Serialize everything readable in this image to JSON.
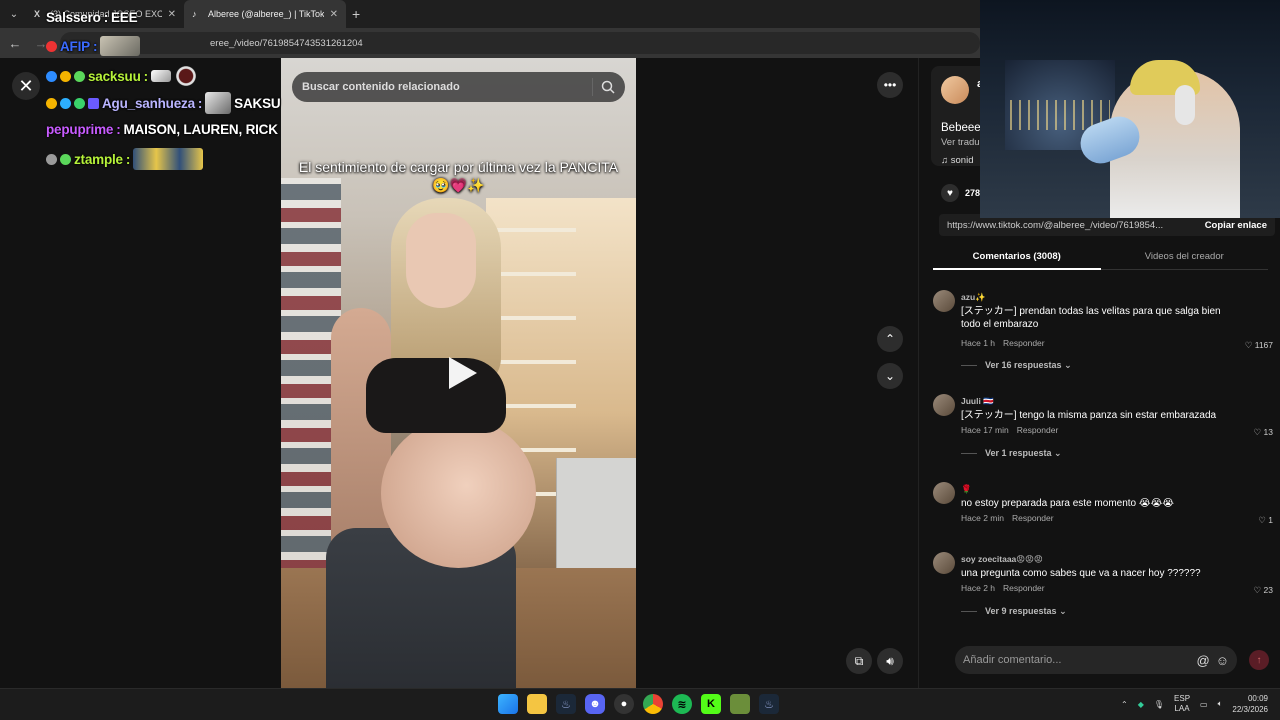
{
  "browser": {
    "tabs": [
      {
        "title": "(3) Comunidad JOSEO EXCLU...",
        "favicon": "X",
        "active": false
      },
      {
        "title": "Alberee (@alberee_) | TikTok",
        "favicon": "♪",
        "active": true
      }
    ],
    "url_visible": "eree_/video/7619854743531261204"
  },
  "page": {
    "search_placeholder": "Buscar contenido relacionado",
    "video_caption": "El sentimiento de cargar por última vez la PANCITA🥹💗✨",
    "creator_initial": "a",
    "description": "Bebeee",
    "translate_label": "Ver tradu",
    "music_label": "♫  sonid",
    "likes": "278.",
    "share_link": "https://www.tiktok.com/@alberee_/video/7619854...",
    "copy_link_label": "Copiar enlace",
    "tabs": {
      "comments": "Comentarios (3008)",
      "creator_videos": "Videos del creador"
    },
    "comments": [
      {
        "user": "azu✨",
        "text": "[ステッカー] prendan todas las velitas para que salga bien todo el embarazo",
        "time": "Hace 1 h",
        "reply": "Responder",
        "likes": "1167",
        "more_replies": "Ver 16 respuestas"
      },
      {
        "user": "Juuli 🇨🇷",
        "text": "[ステッカー] tengo la misma panza sin estar embarazada",
        "time": "Hace 17 min",
        "reply": "Responder",
        "likes": "13",
        "more_replies": "Ver 1 respuesta"
      },
      {
        "user": "🌹",
        "text": "no estoy preparada para este momento 😭😭😭",
        "time": "Hace 2 min",
        "reply": "Responder",
        "likes": "1",
        "more_replies": ""
      },
      {
        "user": "soy zoecitaaa😡😡😡",
        "text": "una pregunta como sabes que va a nacer hoy ??????",
        "time": "Hace 2 h",
        "reply": "Responder",
        "likes": "23",
        "more_replies": "Ver 9 respuestas"
      }
    ],
    "add_comment_placeholder": "Añadir comentario..."
  },
  "stream_chat": [
    {
      "user": "Salssero",
      "user_color": "#ffffff",
      "message": "EEE"
    },
    {
      "user": "AFIP",
      "user_color": "#3b6bff",
      "message": ""
    },
    {
      "user": "sacksuu",
      "user_color": "#b6f23a",
      "message": ""
    },
    {
      "user": "Agu_sanhueza",
      "user_color": "#b9b4ff",
      "message": "SAKSU"
    },
    {
      "user": "pepuprime",
      "user_color": "#c85cff",
      "message": "MAISON, LAUREN, RICK"
    },
    {
      "user": "ztample",
      "user_color": "#b6f23a",
      "message": ""
    }
  ],
  "taskbar": {
    "lang_top": "ESP",
    "lang_bottom": "LAA",
    "time": "00:09",
    "date": "22/3/2026"
  },
  "colors": {
    "accent_red": "#fe2c55",
    "panel": "#121212"
  }
}
